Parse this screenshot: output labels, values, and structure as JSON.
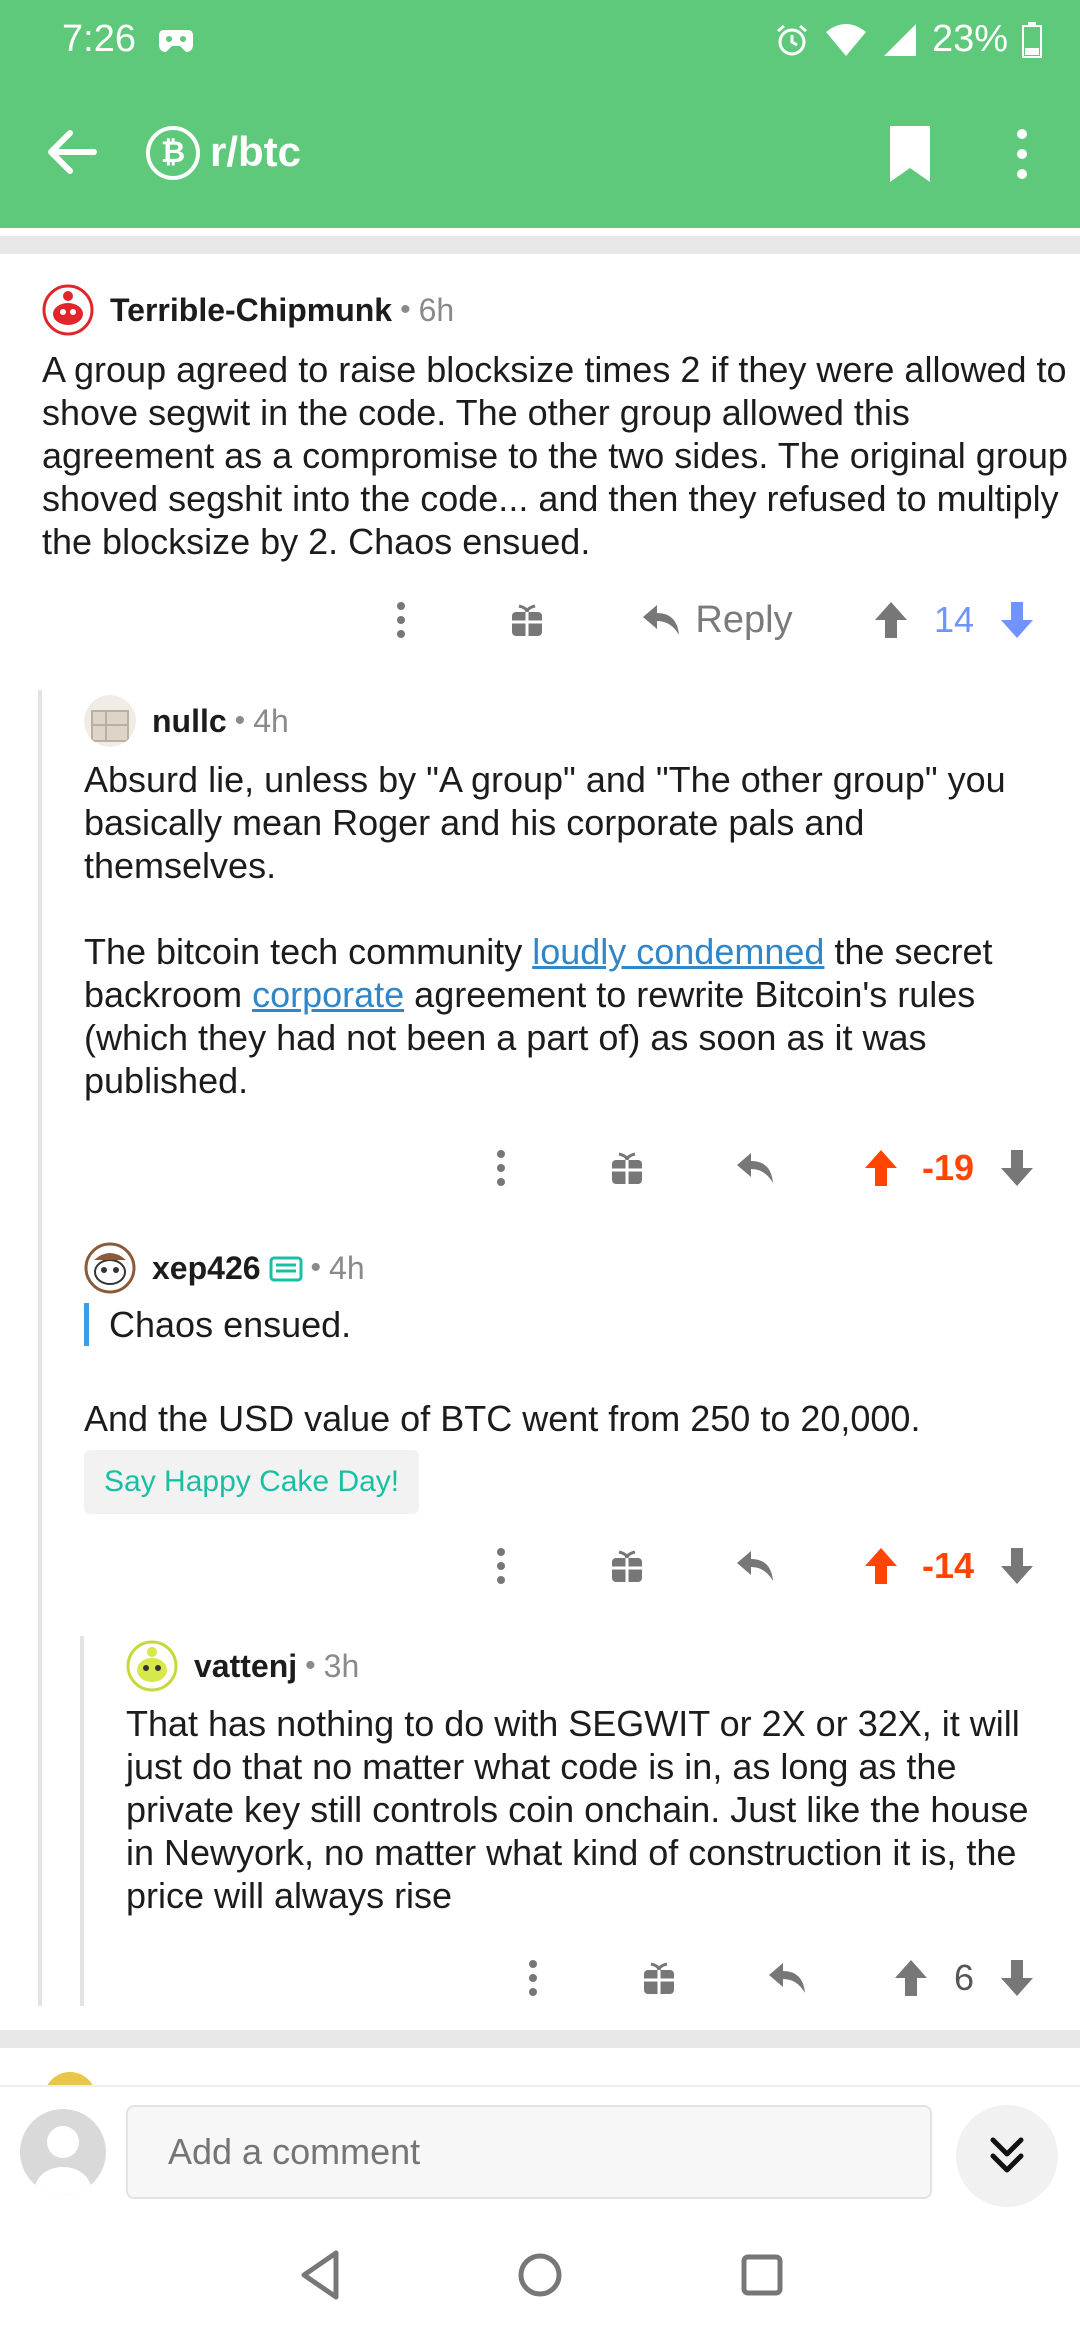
{
  "status": {
    "time": "7:26",
    "battery": "23%"
  },
  "toolbar": {
    "subreddit": "r/btc",
    "sub_icon_glyph": "₿"
  },
  "colors": {
    "header": "#5ec97a",
    "upvote_blue": "#7193ff",
    "downvote_orange": "#ff4500",
    "link": "#2f86c8",
    "cake": "#19bfa3"
  },
  "comments": [
    {
      "author": "Terrible-Chipmunk",
      "age": "6h",
      "body": "A group agreed to raise blocksize times 2 if they were allowed to shove segwit in the code.  The other group allowed this agreement as a compromise to the two sides.  The original group shoved segshit into the code... and then they refused to multiply the blocksize by 2.  Chaos ensued.",
      "reply_label": "Reply",
      "score": "14"
    },
    {
      "author": "nullc",
      "age": "4h",
      "body_p1": "Absurd lie, unless by \"A group\" and \"The other group\" you basically mean Roger and his corporate pals and themselves.",
      "body_p2_a": "The bitcoin tech community ",
      "body_p2_link1": "loudly condemned",
      "body_p2_b": " the secret backroom ",
      "body_p2_link2": "corporate",
      "body_p2_c": " agreement to rewrite Bitcoin's rules (which they had not been a part of) as soon as it was published.",
      "score": "-19"
    },
    {
      "author": "xep426",
      "age": "4h",
      "quote": "Chaos ensued.",
      "body": "And the USD value of BTC went from 250 to 20,000.",
      "cake_label": "Say Happy Cake Day!",
      "score": "-14"
    },
    {
      "author": "vattenj",
      "age": "3h",
      "body": "That has nothing to do with SEGWIT or 2X or 32X, it will just do that no matter what code is in, as long as the private key still controls coin onchain. Just like the house in Newyork, no matter what kind of construction it is, the price will always rise",
      "score": "6"
    }
  ],
  "separator": "•",
  "composer": {
    "placeholder": "Add a comment"
  }
}
